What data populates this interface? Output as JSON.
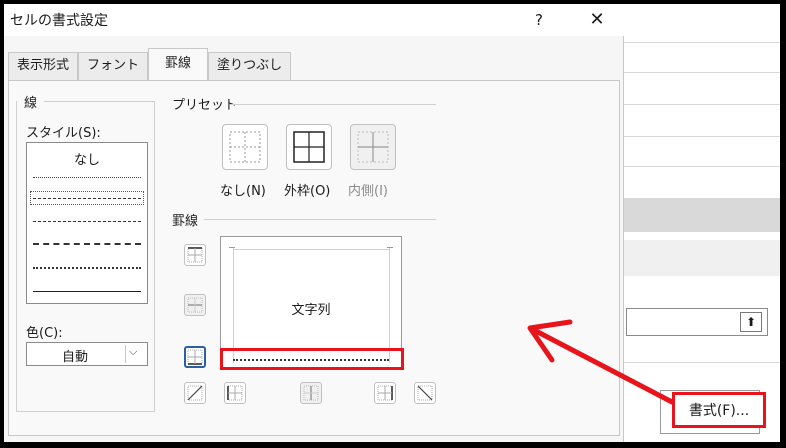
{
  "dialog": {
    "title": "セルの書式設定",
    "help": "?",
    "close": "✕",
    "tabs": [
      {
        "label": "表示形式",
        "active": false
      },
      {
        "label": "フォント",
        "active": false
      },
      {
        "label": "罫線",
        "active": true
      },
      {
        "label": "塗りつぶし",
        "active": false
      }
    ]
  },
  "line_group": {
    "title": "線",
    "style_label": "スタイル(S):",
    "style_none": "なし",
    "color_label": "色(C):",
    "color_value": "自動",
    "dropdown_glyph": "⌵"
  },
  "preset_group": {
    "title": "プリセット",
    "none_label": "なし(N)",
    "outline_label": "外枠(O)",
    "inside_label": "内側(I)"
  },
  "border_group": {
    "title": "罫線",
    "preview_text": "文字列"
  },
  "background": {
    "format_button": "書式(F)...",
    "upload_glyph": "⬆"
  },
  "colors": {
    "highlight": "#e8141c",
    "selected_border": "#2a5fa8"
  }
}
